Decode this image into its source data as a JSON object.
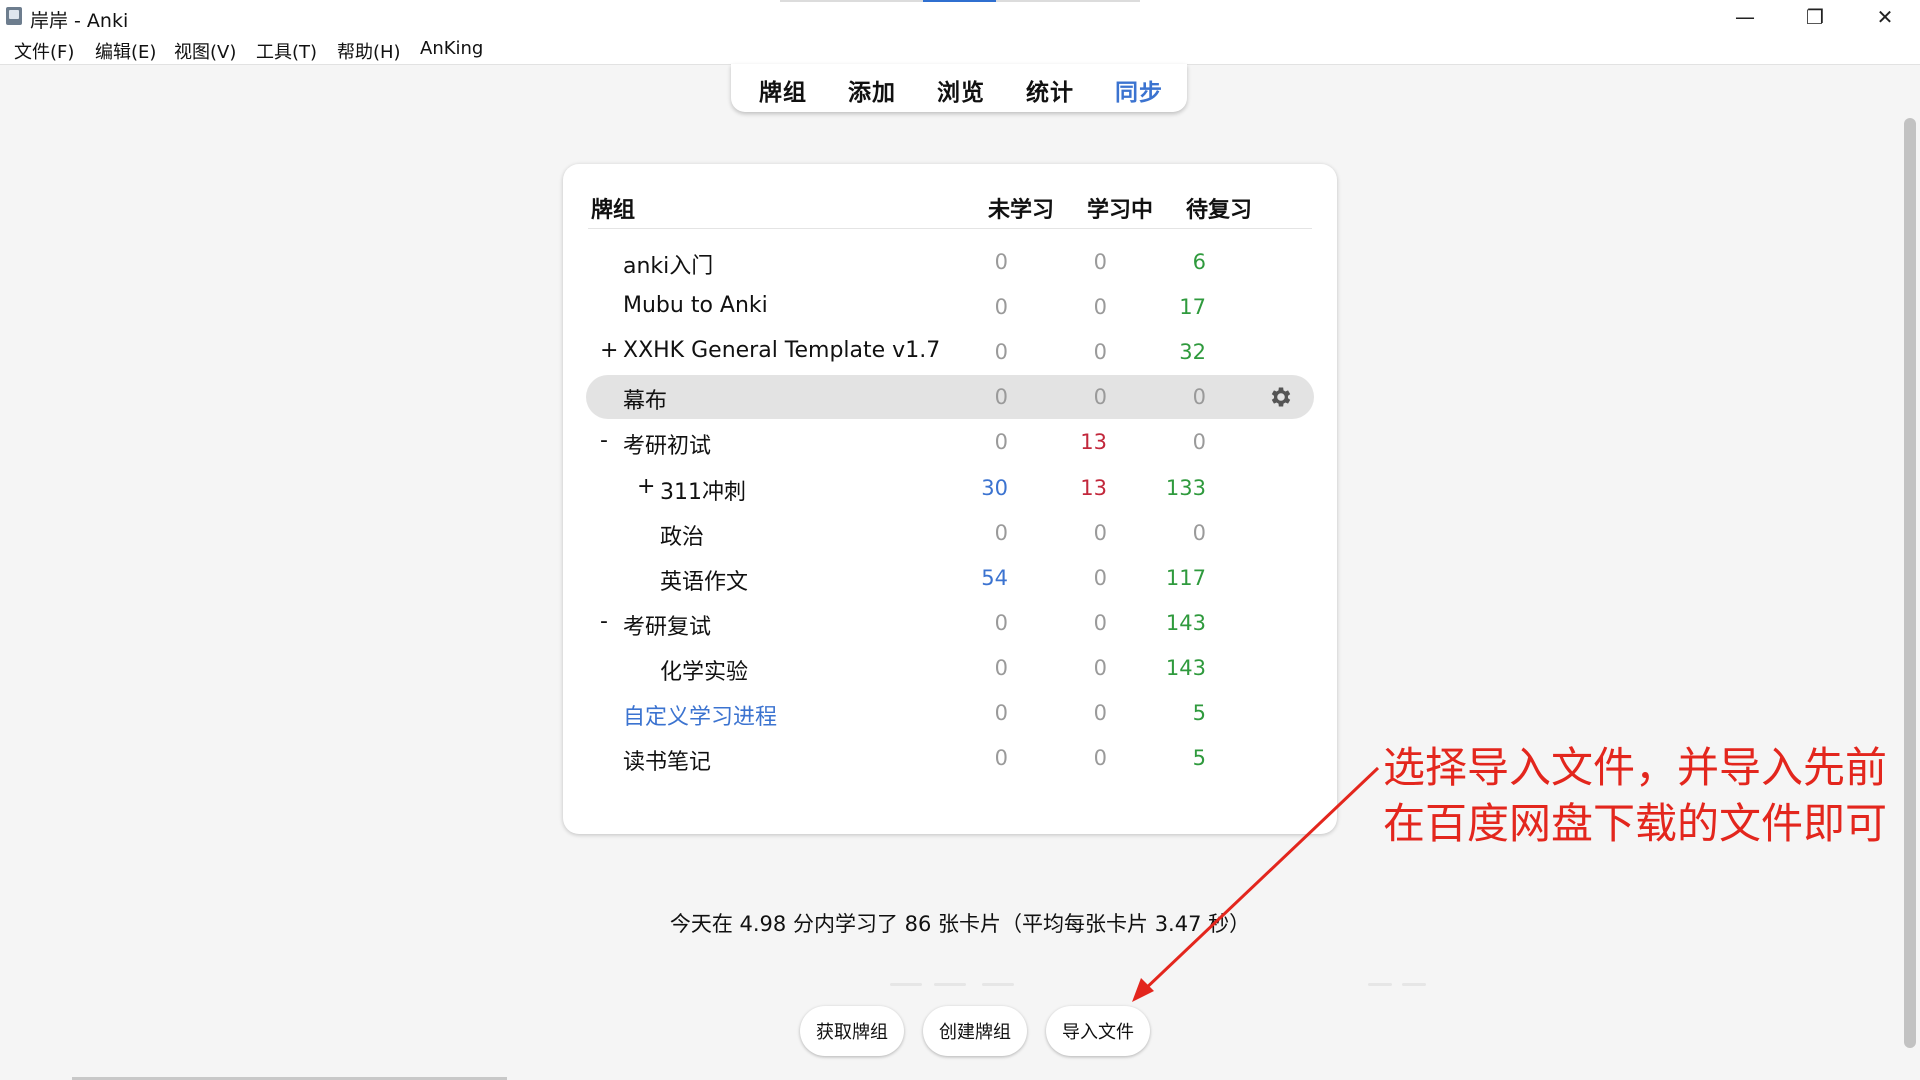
{
  "window": {
    "title": "岸岸 - Anki",
    "minimize_glyph": "—",
    "maximize_glyph": "❐",
    "close_glyph": "✕"
  },
  "menu": [
    "文件(F)",
    "编辑(E)",
    "视图(V)",
    "工具(T)",
    "帮助(H)",
    "AnKing"
  ],
  "toolbar": {
    "items": [
      "牌组",
      "添加",
      "浏览",
      "统计",
      "同步"
    ],
    "sync_color": "#3b73d0"
  },
  "deck_table": {
    "headers": {
      "deck": "牌组",
      "new": "未学习",
      "learning": "学习中",
      "review": "待复习"
    },
    "rows": [
      {
        "expander": "",
        "name": "anki入门",
        "new": "0",
        "learning": "0",
        "review": "6"
      },
      {
        "expander": "",
        "name": "Mubu to Anki",
        "new": "0",
        "learning": "0",
        "review": "17"
      },
      {
        "expander": "+",
        "name": "XXHK General Template v1.7",
        "new": "0",
        "learning": "0",
        "review": "32"
      },
      {
        "expander": "",
        "name": "幕布",
        "new": "0",
        "learning": "0",
        "review": "0",
        "current": true
      },
      {
        "expander": "-",
        "name": "考研初试",
        "new": "0",
        "learning": "13",
        "review": "0"
      },
      {
        "expander": "+",
        "name": "311冲刺",
        "new": "30",
        "learning": "13",
        "review": "133"
      },
      {
        "expander": "",
        "name": "政治",
        "new": "0",
        "learning": "0",
        "review": "0"
      },
      {
        "expander": "",
        "name": "英语作文",
        "new": "54",
        "learning": "0",
        "review": "117"
      },
      {
        "expander": "-",
        "name": "考研复试",
        "new": "0",
        "learning": "0",
        "review": "143"
      },
      {
        "expander": "",
        "name": "化学实验",
        "new": "0",
        "learning": "0",
        "review": "143"
      },
      {
        "expander": "",
        "name": "自定义学习进程",
        "new": "0",
        "learning": "0",
        "review": "5",
        "filtered": true
      },
      {
        "expander": "",
        "name": "读书笔记",
        "new": "0",
        "learning": "0",
        "review": "5"
      }
    ],
    "options_icon": "gear-icon"
  },
  "summary": "今天在 4.98 分内学习了 86 张卡片（平均每张卡片 3.47 秒）",
  "buttons": {
    "get_shared": "获取牌组",
    "create_deck": "创建牌组",
    "import_file": "导入文件"
  },
  "annotation": {
    "line1": "选择导入文件，并导入先前",
    "line2": "在百度网盘下载的文件即可",
    "color": "#e3261d"
  },
  "colors": {
    "new": "#3b73d0",
    "learning": "#c2273b",
    "review": "#2f9a3d",
    "zero": "#9a9a9a",
    "filtered_deck": "#3b73d0"
  }
}
